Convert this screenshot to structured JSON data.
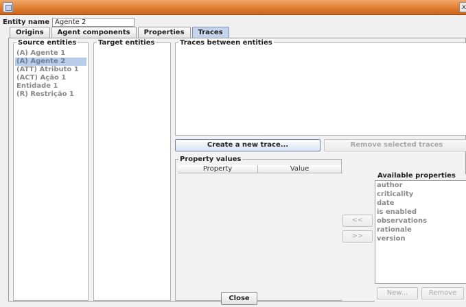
{
  "entity": {
    "label": "Entity name",
    "value": "Agente 2"
  },
  "tabs": [
    {
      "label": "Origins",
      "active": false
    },
    {
      "label": "Agent components",
      "active": false
    },
    {
      "label": "Properties",
      "active": false
    },
    {
      "label": "Traces",
      "active": true
    }
  ],
  "source": {
    "title": "Source entities",
    "items": [
      "(A) Agente 1",
      "(A) Agente 2",
      "(ATT) Atributo 1",
      "(ACT) Ação 1",
      "Entidade 1",
      "(R) Restrição 1"
    ],
    "selected_index": 1
  },
  "target": {
    "title": "Target entities"
  },
  "traces": {
    "title": "Traces between entities"
  },
  "buttons": {
    "create": "Create a new trace...",
    "remove_selected": "Remove selected traces",
    "move_left": "<<",
    "move_right": ">>",
    "new": "New...",
    "remove": "Remove",
    "close": "Close",
    "window_close": "x"
  },
  "property_values": {
    "title": "Property values",
    "columns": [
      "Property",
      "Value"
    ]
  },
  "available": {
    "title": "Available properties",
    "items": [
      "author",
      "criticality",
      "date",
      "is enabled",
      "observations",
      "rationale",
      "version"
    ]
  }
}
